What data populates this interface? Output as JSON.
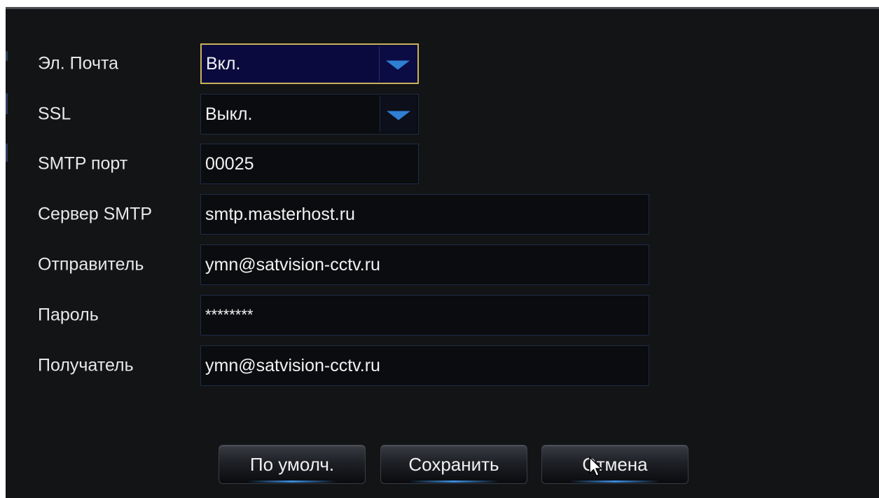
{
  "form": {
    "email": {
      "label": "Эл. Почта",
      "value": "Вкл."
    },
    "ssl": {
      "label": "SSL",
      "value": "Выкл."
    },
    "smtp_port": {
      "label": "SMTP порт",
      "value": "00025"
    },
    "smtp_server": {
      "label": "Сервер SMTP",
      "value": "smtp.masterhost.ru"
    },
    "sender": {
      "label": "Отправитель",
      "value": "ymn@satvision-cctv.ru"
    },
    "password": {
      "label": "Пароль",
      "value": "********"
    },
    "recipient": {
      "label": "Получатель",
      "value": "ymn@satvision-cctv.ru"
    }
  },
  "buttons": {
    "default_label": "По умолч.",
    "save_label": "Сохранить",
    "cancel_label": "Отмена"
  },
  "icons": {
    "dropdown": "chevron-down-icon",
    "cursor": "mouse-cursor-icon"
  },
  "colors": {
    "background": "#131416",
    "focus_border": "#c9b25a",
    "focus_fill": "#0a0a3e",
    "accent": "#2f7fd3",
    "text": "#e8e8e8"
  }
}
